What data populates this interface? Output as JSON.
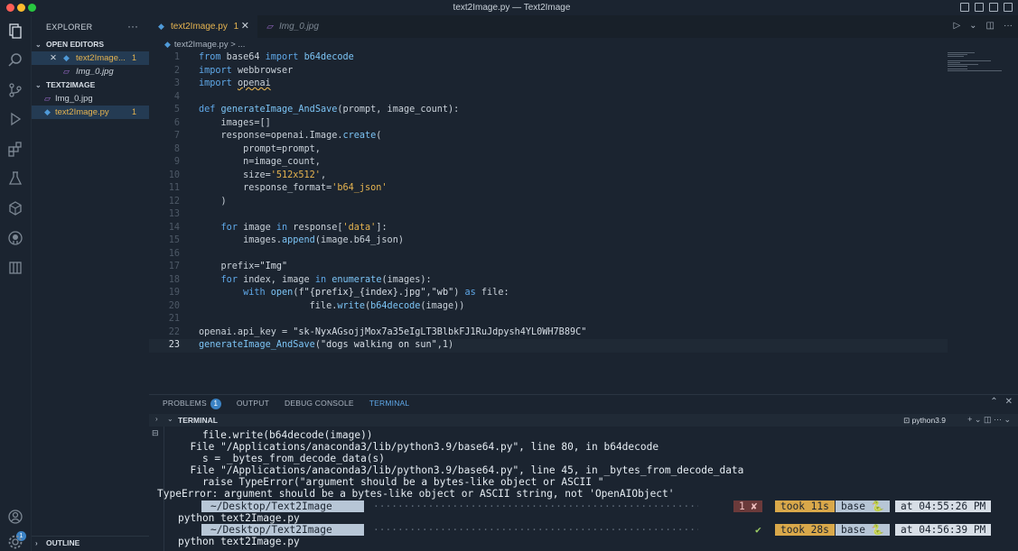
{
  "window": {
    "title": "text2Image.py — Text2Image"
  },
  "activity_bar": {
    "items": [
      "explorer-icon",
      "search-icon",
      "source-control-icon",
      "run-debug-icon",
      "extensions-icon",
      "testing-icon",
      "remote-icon",
      "github-icon",
      "containers-icon"
    ],
    "account_badge": "1"
  },
  "sidebar": {
    "title": "EXPLORER",
    "more": "···",
    "open_editors": {
      "label": "OPEN EDITORS",
      "items": [
        {
          "name": "text2Image...",
          "count": "1"
        },
        {
          "name": "Img_0.jpg"
        }
      ]
    },
    "project": {
      "label": "TEXT2IMAGE",
      "files": [
        {
          "name": "Img_0.jpg"
        },
        {
          "name": "text2Image.py",
          "count": "1"
        }
      ]
    },
    "outline": "OUTLINE"
  },
  "editor": {
    "tabs": [
      {
        "label": "text2Image.py",
        "count": "1"
      },
      {
        "label": "Img_0.jpg"
      }
    ],
    "breadcrumb": "text2Image.py > ...",
    "lines": [
      "from base64 import b64decode",
      "import webbrowser",
      "import openai",
      "",
      "def generateImage_AndSave(prompt, image_count):",
      "    images=[]",
      "    response=openai.Image.create(",
      "        prompt=prompt,",
      "        n=image_count,",
      "        size='512x512',",
      "        response_format='b64_json'",
      "    )",
      "",
      "    for image in response['data']:",
      "        images.append(image.b64_json)",
      "",
      "    prefix=\"Img\"",
      "    for index, image in enumerate(images):",
      "        with open(f\"{prefix}_{index}.jpg\",\"wb\") as file:",
      "                    file.write(b64decode(image))",
      "",
      "openai.api_key = \"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\"",
      "generateImage_AndSave(\"dogs walking on sun\",1)"
    ]
  },
  "panel": {
    "tabs": [
      "PROBLEMS",
      "OUTPUT",
      "DEBUG CONSOLE",
      "TERMINAL"
    ],
    "problems_count": "1",
    "terminal_label": "TERMINAL",
    "shell": "python3.9",
    "output": [
      "    file.write(b64decode(image))",
      "  File \"/Applications/anaconda3/lib/python3.9/base64.py\", line 80, in b64decode",
      "    s = _bytes_from_decode_data(s)",
      "  File \"/Applications/anaconda3/lib/python3.9/base64.py\", line 45, in _bytes_from_decode_data",
      "    raise TypeError(\"argument should be a bytes-like object or ASCII \"",
      "TypeError: argument should be a bytes-like object or ASCII string, not 'OpenAIObject'"
    ],
    "prompts": [
      {
        "path": "~/Desktop/Text2Image",
        "status": "1 ✘",
        "took": "took 11s",
        "env": "base 🐍",
        "time": "at 04:55:26 PM",
        "command": "python text2Image.py"
      },
      {
        "path": "~/Desktop/Text2Image",
        "status": "✔",
        "took": "took 28s",
        "env": "base 🐍",
        "time": "at 04:56:39 PM",
        "command": "python text2Image.py"
      }
    ]
  }
}
